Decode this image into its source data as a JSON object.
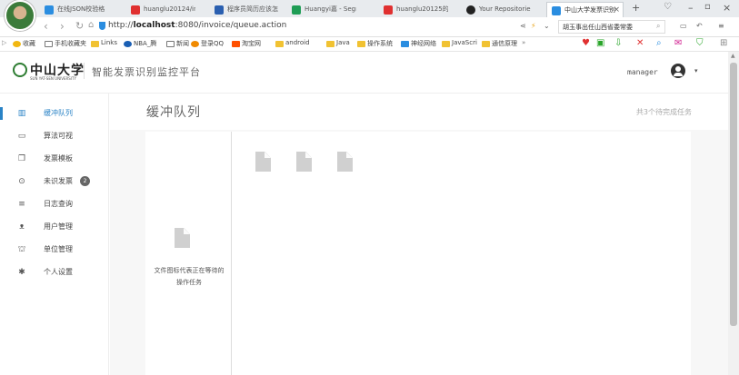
{
  "browser": {
    "tabs": [
      {
        "label": "在线JSON校验格",
        "color": "#2a8de0"
      },
      {
        "label": "huanglu20124/in",
        "color": "#e03030"
      },
      {
        "label": "程序员简历应该怎",
        "color": "#2a5fb0"
      },
      {
        "label": "Huangyi嘉 - Segn",
        "color": "#1f9d55"
      },
      {
        "label": "huanglu20125的",
        "color": "#e03030"
      },
      {
        "label": "Your Repositorie",
        "color": "#222222"
      },
      {
        "label": "中山大学发票识别",
        "color": "#2a8de0"
      }
    ],
    "url_prefix": "http://",
    "url_host": "localhost",
    "url_path": ":8080/invoice/queue.action",
    "search_text": "胡玉事出任山西省委常委",
    "bookmarks": [
      "收藏",
      "手机收藏夹",
      "Links",
      "NBA_腾",
      "新闻",
      "登录QQ",
      "淘宝网",
      "android",
      "Java",
      "操作系统",
      "神经网络",
      "JavaScri",
      "通信原理"
    ],
    "more": "»"
  },
  "header": {
    "logo_text": "中山大学",
    "logo_sub": "SUN YAT-SEN UNIVERSITY",
    "platform_title": "智能发票识别监控平台",
    "username": "manager"
  },
  "sidebar": {
    "items": [
      {
        "label": "缓冲队列",
        "icon": "bar-chart-icon",
        "glyph": "▥",
        "active": true
      },
      {
        "label": "算法可视",
        "icon": "monitor-icon",
        "glyph": "▭",
        "active": false
      },
      {
        "label": "发票模板",
        "icon": "copy-icon",
        "glyph": "❐",
        "active": false
      },
      {
        "label": "未识发票",
        "icon": "circle-icon",
        "glyph": "⊙",
        "active": false,
        "badge": "2"
      },
      {
        "label": "日志查询",
        "icon": "list-icon",
        "glyph": "≡",
        "active": false
      },
      {
        "label": "用户管理",
        "icon": "user-icon",
        "glyph": "ᴥ",
        "active": false
      },
      {
        "label": "单位管理",
        "icon": "bank-icon",
        "glyph": "⛫",
        "active": false
      },
      {
        "label": "个人设置",
        "icon": "gear-icon",
        "glyph": "✱",
        "active": false
      }
    ]
  },
  "main": {
    "title": "缓冲队列",
    "meta": "共3个待完成任务",
    "legend_text": "文件图标代表正在等待的操作任务",
    "queue_count": 3
  },
  "colors": {
    "accent": "#2a83c6",
    "doc_icon": "#d0d0d0"
  }
}
